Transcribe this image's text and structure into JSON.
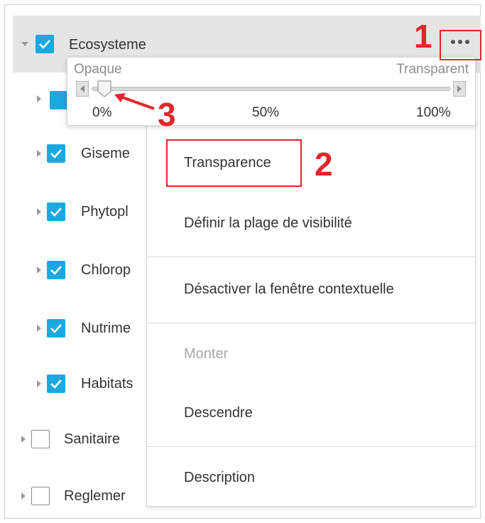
{
  "tree": {
    "header": {
      "label": "Ecosysteme",
      "checked": true,
      "more_icon": "ellipsis-icon"
    },
    "children": [
      {
        "label": "Giseme",
        "checked": true
      },
      {
        "label": "Phytopl",
        "checked": true
      },
      {
        "label": "Chlorop",
        "checked": true
      },
      {
        "label": "Nutrime",
        "checked": true
      },
      {
        "label": "Habitats",
        "checked": true
      }
    ],
    "siblings": [
      {
        "label": "Sanitaire",
        "checked": false
      },
      {
        "label": "Reglemer",
        "checked": false
      }
    ]
  },
  "popup": {
    "left_label": "Opaque",
    "right_label": "Transparent",
    "ticks": [
      "0%",
      "50%",
      "100%"
    ],
    "value_fraction": 0.0
  },
  "menu": {
    "items": [
      {
        "label": "Transparence",
        "disabled": false
      },
      {
        "label": "Définir la plage de visibilité",
        "disabled": false
      },
      {
        "label": "Désactiver la fenêtre contextuelle",
        "disabled": false
      },
      {
        "label": "Monter",
        "disabled": true
      },
      {
        "label": "Descendre",
        "disabled": false
      },
      {
        "label": "Description",
        "disabled": false
      }
    ]
  },
  "annotations": {
    "n1": "1",
    "n2": "2",
    "n3": "3",
    "color": "#e2262b"
  },
  "colors": {
    "checkbox_on": "#1aa9df",
    "header_bg": "#e5e5e5"
  }
}
